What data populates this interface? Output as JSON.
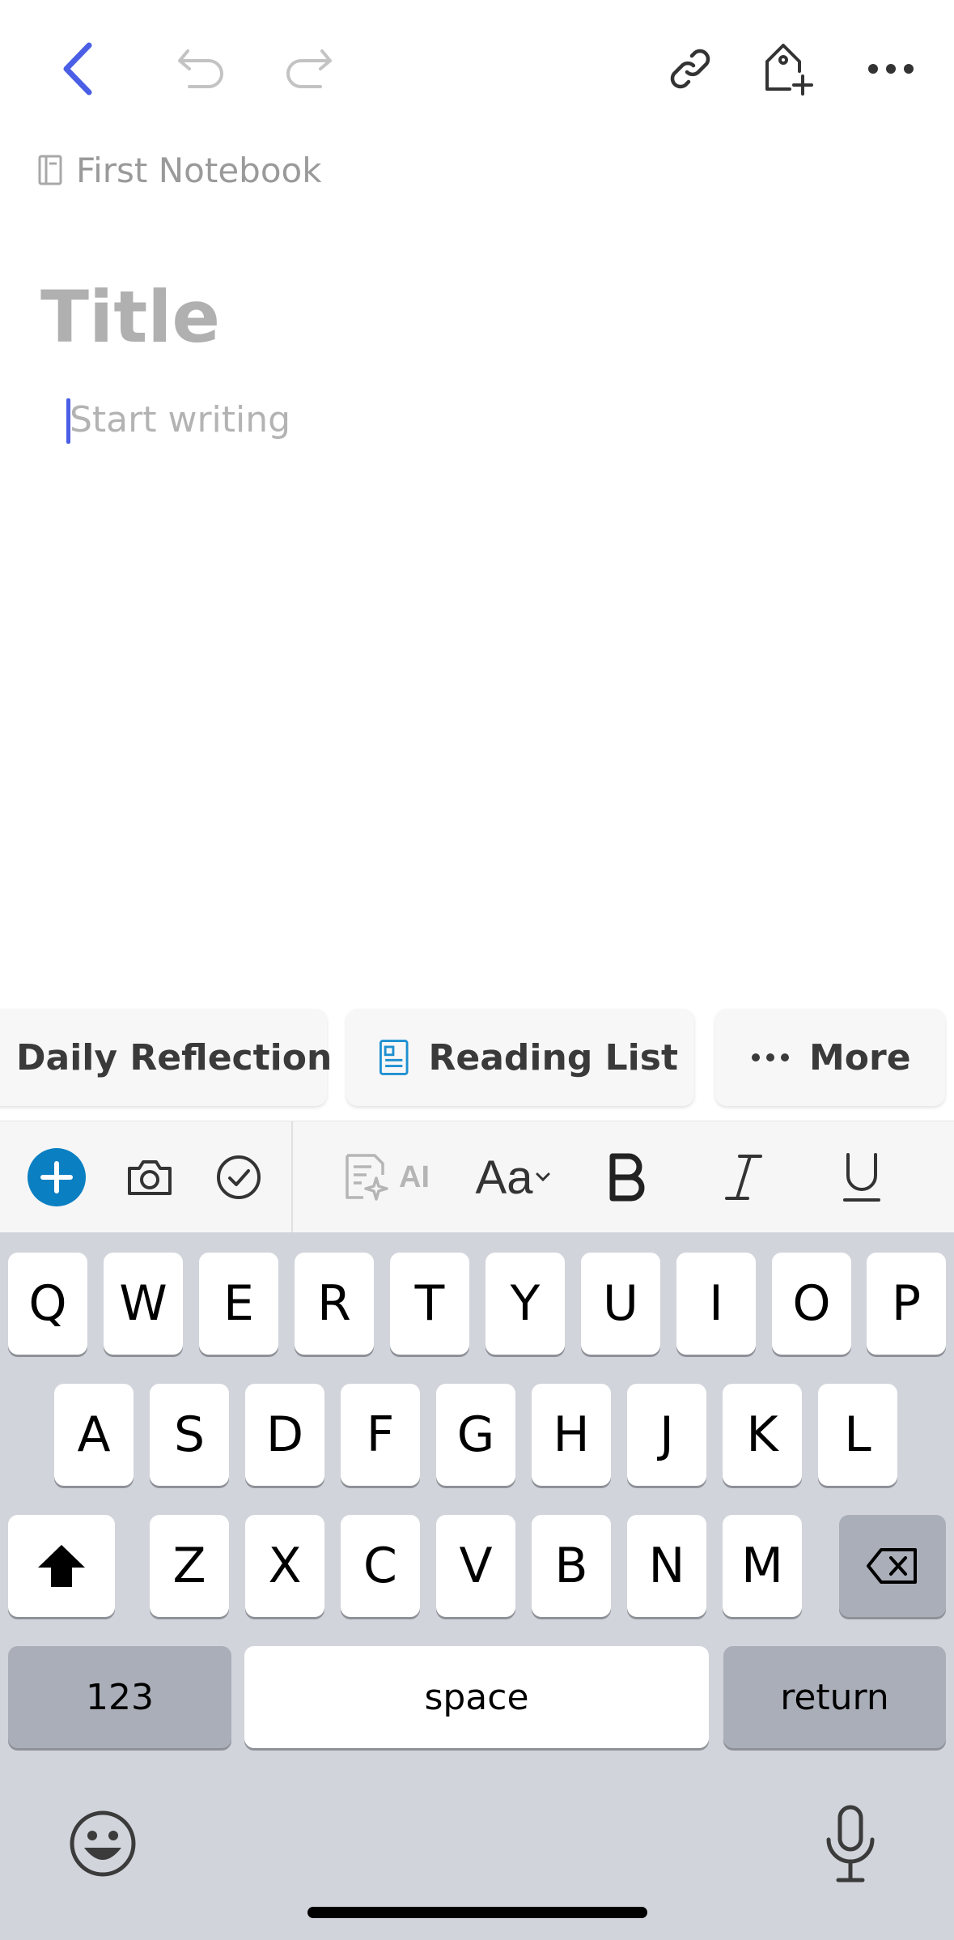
{
  "notebook": {
    "name": "First Notebook"
  },
  "editor": {
    "title_placeholder": "Title",
    "body_placeholder": "Start writing"
  },
  "templates": [
    {
      "label": "Daily Reflection"
    },
    {
      "label": "Reading List",
      "icon": "document-template-icon"
    },
    {
      "label": "More",
      "icon": "ellipsis-icon"
    }
  ],
  "format_bar": {
    "ai_label": "AI",
    "font_label": "Aa"
  },
  "keyboard": {
    "row1": [
      "Q",
      "W",
      "E",
      "R",
      "T",
      "Y",
      "U",
      "I",
      "O",
      "P"
    ],
    "row2": [
      "A",
      "S",
      "D",
      "F",
      "G",
      "H",
      "J",
      "K",
      "L"
    ],
    "row3": [
      "Z",
      "X",
      "C",
      "V",
      "B",
      "N",
      "M"
    ],
    "numbers": "123",
    "space": "space",
    "return": "return"
  },
  "colors": {
    "accent": "#4a5fe6",
    "add_button": "#0a7fc2",
    "template_icon": "#1e8fd0"
  }
}
